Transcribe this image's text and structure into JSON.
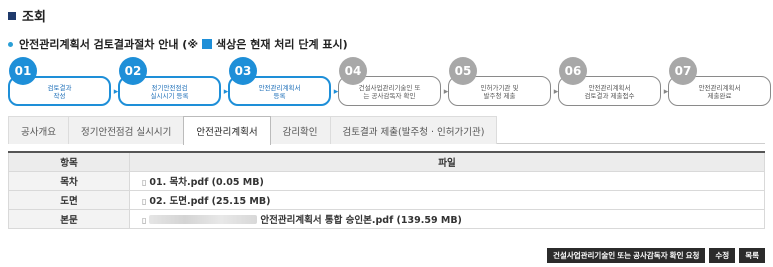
{
  "page": {
    "title": "조회",
    "guide_text_before": "안전관리계획서 검토결과절차 안내 (※",
    "guide_text_after": "색상은 현재 처리 단계 표시)"
  },
  "steps": [
    {
      "num": "01",
      "label": "검토결과\n작성",
      "active": true
    },
    {
      "num": "02",
      "label": "정기안전점검\n실시시기 등록",
      "active": true
    },
    {
      "num": "03",
      "label": "안전관리계획서\n등록",
      "active": true
    },
    {
      "num": "04",
      "label": "건설사업관리기술인 또\n는 공사감독자 확인",
      "active": false
    },
    {
      "num": "05",
      "label": "인허가기관 및\n발주청 제출",
      "active": false
    },
    {
      "num": "06",
      "label": "안전관리계획서\n검토결과 제출접수",
      "active": false
    },
    {
      "num": "07",
      "label": "안전관리계획서\n제출완료",
      "active": false
    }
  ],
  "tabs": [
    {
      "label": "공사개요",
      "active": false
    },
    {
      "label": "정기안전점검 실시시기",
      "active": false
    },
    {
      "label": "안전관리계획서",
      "active": true
    },
    {
      "label": "감리확인",
      "active": false
    },
    {
      "label": "검토결과 제출(발주청 · 인허가기관)",
      "active": false
    }
  ],
  "table": {
    "headers": [
      "항목",
      "파일"
    ],
    "rows": [
      {
        "label": "목차",
        "file": "01. 목차.pdf (0.05 MB)",
        "redacted": false
      },
      {
        "label": "도면",
        "file": "02. 도면.pdf (25.15 MB)",
        "redacted": false
      },
      {
        "label": "본문",
        "file": "안전관리계획서 통합 승인본.pdf (139.59 MB)",
        "redacted": true
      }
    ]
  },
  "buttons": {
    "confirm_request": "건설사업관리기술인 또는 공사감독자 확인 요청",
    "edit": "수정",
    "list": "목록"
  },
  "colors": {
    "accent": "#1e8fd8",
    "inactive": "#a8a8a8",
    "title_square": "#1f3a6b",
    "button_bg": "#2b2b2b"
  },
  "icons": {
    "file": "file-icon",
    "arrow": "chevron-right-icon"
  }
}
